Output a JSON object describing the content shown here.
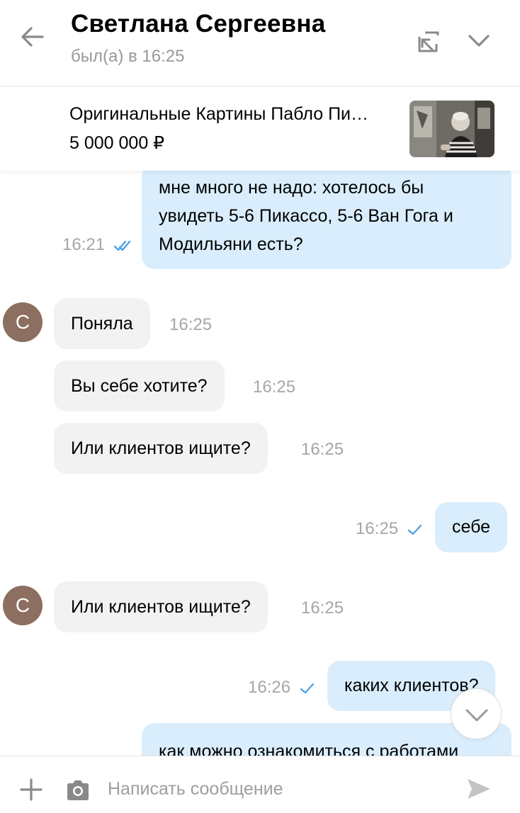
{
  "header": {
    "contact_name": "Светлана Сергеевна",
    "status": "был(а) в 16:25",
    "icons": {
      "back": "arrow-left-icon",
      "expand": "open-in-window-icon",
      "menu": "chevron-down-icon"
    }
  },
  "listing": {
    "title": "Оригинальные Картины Пабло Пи…",
    "price": "5 000 000 ₽"
  },
  "messages": [
    {
      "direction": "out",
      "lines": [
        "мне много не надо: хотелось бы",
        "увидеть 5-6 Пикассо, 5-6 Ван Гога и",
        "Модильяни есть?"
      ],
      "time": "16:21",
      "status": "read"
    },
    {
      "direction": "in",
      "avatar": "С",
      "text": "Поняла",
      "time": "16:25"
    },
    {
      "direction": "in",
      "text": "Вы себе хотите?",
      "time": "16:25"
    },
    {
      "direction": "in",
      "text": "Или клиентов ищите?",
      "time": "16:25"
    },
    {
      "direction": "out",
      "text": "себе",
      "time": "16:25",
      "status": "sent"
    },
    {
      "direction": "in",
      "avatar": "С",
      "text": "Или клиентов ищите?",
      "time": "16:25"
    },
    {
      "direction": "out",
      "text": "каких клиентов?",
      "time": "16:26",
      "status": "sent"
    },
    {
      "direction": "out",
      "text": "как можно ознакомиться с работами",
      "partial": true
    }
  ],
  "composer": {
    "placeholder": "Написать сообщение",
    "icons": {
      "attach": "plus-icon",
      "camera": "camera-icon",
      "send": "send-icon"
    }
  },
  "colors": {
    "accent": "#4da3e8",
    "outgoing_bubble": "#d9edfc",
    "incoming_bubble": "#f2f2f2",
    "avatar": "#8c6f60",
    "muted_text": "#a6a6a6"
  }
}
